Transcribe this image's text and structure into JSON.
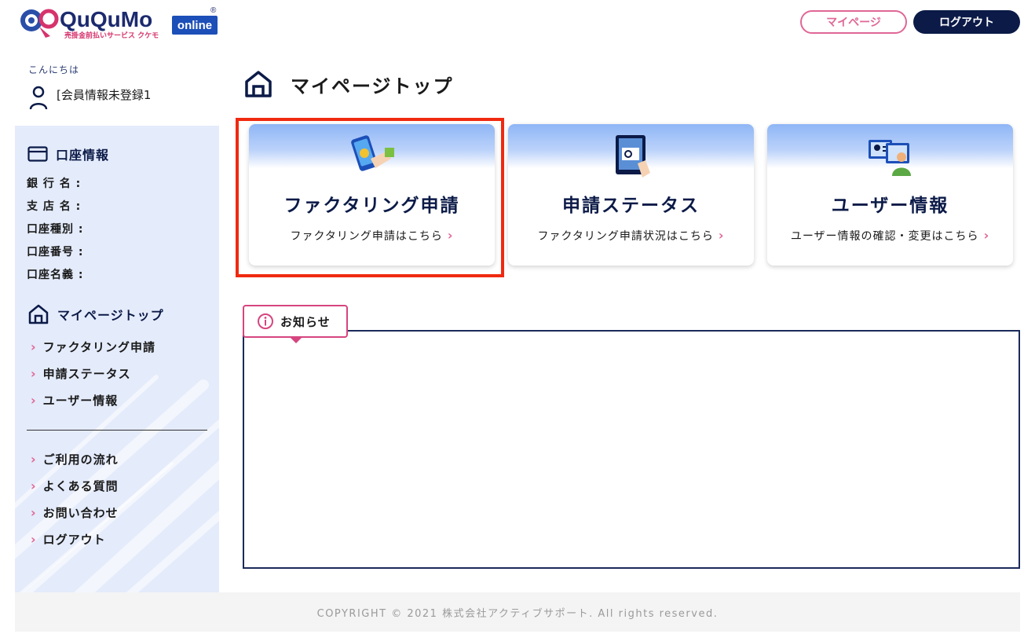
{
  "brand": {
    "name": "QuQuMo",
    "badge": "online",
    "tagline": "売掛金前払いサービス クケモ",
    "registered_mark": "®"
  },
  "header": {
    "mypage_label": "マイページ",
    "logout_label": "ログアウト"
  },
  "greeting": {
    "hello": "こんにちは",
    "user_name": "[会員情報未登録1"
  },
  "sidebar": {
    "account_title": "口座情報",
    "account_fields": [
      "銀 行 名 :",
      "支 店 名 :",
      "口座種別 :",
      "口座番号 :",
      "口座名義 :"
    ],
    "mypage_top": "マイページトップ",
    "nav_main": [
      "ファクタリング申請",
      "申請ステータス",
      "ユーザー情報"
    ],
    "nav_sub": [
      "ご利用の流れ",
      "よくある質問",
      "お問い合わせ",
      "ログアウト"
    ]
  },
  "main": {
    "title": "マイページトップ",
    "cards": [
      {
        "title": "ファクタリング申請",
        "subtitle": "ファクタリング申請はこちら",
        "icon": "phone-hand-icon"
      },
      {
        "title": "申請ステータス",
        "subtitle": "ファクタリング申請状況はこちら",
        "icon": "tablet-touch-icon"
      },
      {
        "title": "ユーザー情報",
        "subtitle": "ユーザー情報の確認・変更はこちら",
        "icon": "user-profile-icon"
      }
    ],
    "news_label": "お知らせ"
  },
  "footer": {
    "copyright": "COPYRIGHT © 2021 株式会社アクティブサポート. All rights reserved."
  },
  "colors": {
    "navy": "#0b1a47",
    "pink": "#e06696",
    "sidebar_bg": "#e4ebfb",
    "highlight_red": "#ef2a10"
  }
}
